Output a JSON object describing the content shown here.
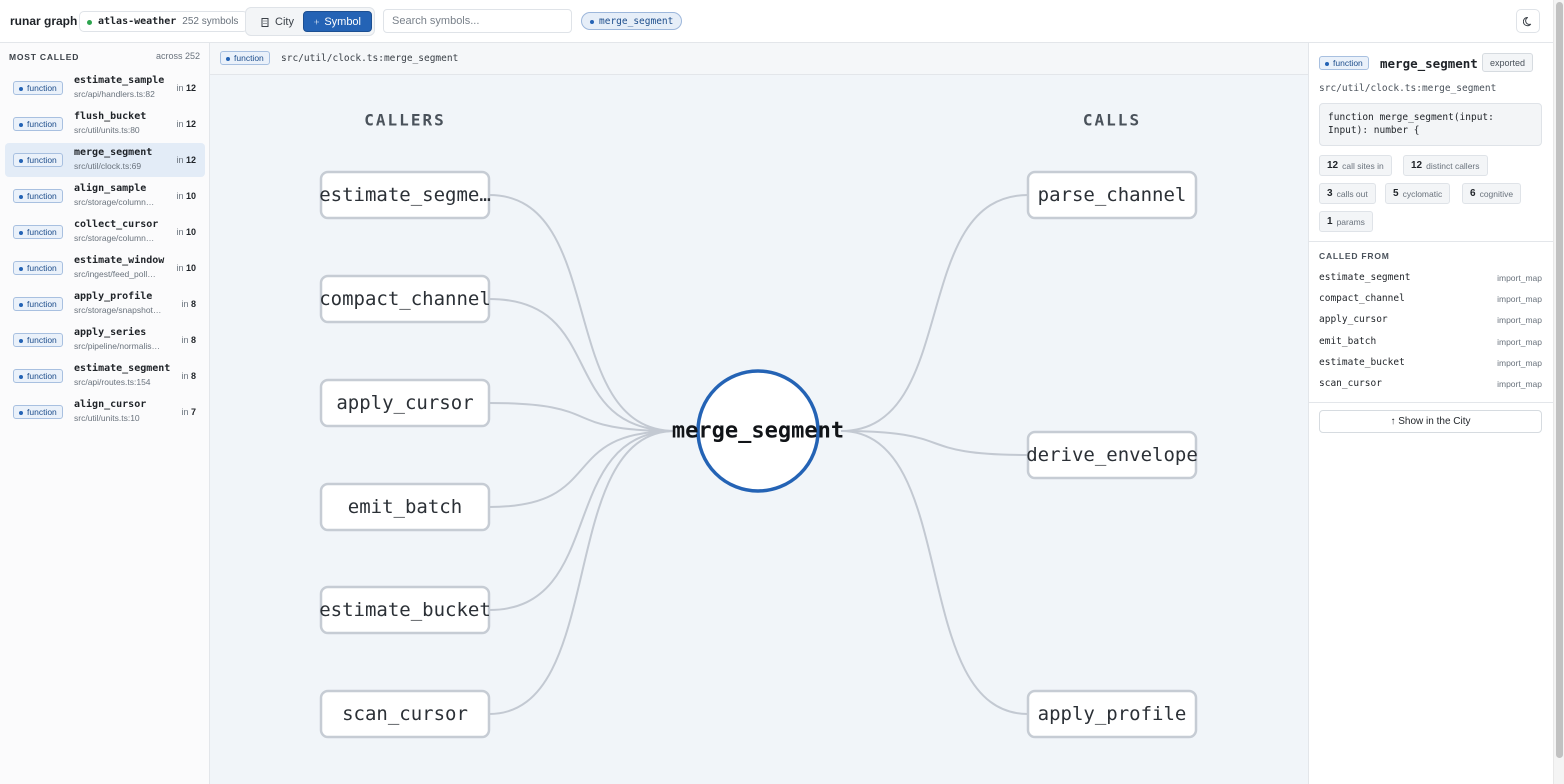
{
  "topbar": {
    "app_title": "runar graph",
    "repo": {
      "name": "atlas-weather",
      "count": "252 symbols",
      "status_color": "#2da44e"
    },
    "modes": {
      "city": "City",
      "symbol": "Symbol",
      "active": "Symbol",
      "city_icon": "building-icon",
      "symbol_icon": "node-graph-icon"
    },
    "search": {
      "placeholder": "Search symbols...",
      "value": ""
    },
    "selected_symbol": "merge_segment",
    "theme_icon": "moon-icon"
  },
  "sidebar": {
    "title": "MOST CALLED",
    "meta": "across 252",
    "items": [
      {
        "kind": "function",
        "name": "estimate_sample",
        "path": "src/api/handlers.ts:82",
        "count_prefix": "in",
        "count": "12",
        "active": false
      },
      {
        "kind": "function",
        "name": "flush_bucket",
        "path": "src/util/units.ts:80",
        "count_prefix": "in",
        "count": "12",
        "active": false
      },
      {
        "kind": "function",
        "name": "merge_segment",
        "path": "src/util/clock.ts:69",
        "count_prefix": "in",
        "count": "12",
        "active": true
      },
      {
        "kind": "function",
        "name": "align_sample",
        "path": "src/storage/column…",
        "count_prefix": "in",
        "count": "10",
        "active": false
      },
      {
        "kind": "function",
        "name": "collect_cursor",
        "path": "src/storage/column…",
        "count_prefix": "in",
        "count": "10",
        "active": false
      },
      {
        "kind": "function",
        "name": "estimate_window",
        "path": "src/ingest/feed_poll…",
        "count_prefix": "in",
        "count": "10",
        "active": false
      },
      {
        "kind": "function",
        "name": "apply_profile",
        "path": "src/storage/snapshot…",
        "count_prefix": "in",
        "count": "8",
        "active": false
      },
      {
        "kind": "function",
        "name": "apply_series",
        "path": "src/pipeline/normalis…",
        "count_prefix": "in",
        "count": "8",
        "active": false
      },
      {
        "kind": "function",
        "name": "estimate_segment",
        "path": "src/api/routes.ts:154",
        "count_prefix": "in",
        "count": "8",
        "active": false
      },
      {
        "kind": "function",
        "name": "align_cursor",
        "path": "src/util/units.ts:10",
        "count_prefix": "in",
        "count": "7",
        "active": false
      }
    ]
  },
  "main": {
    "breadcrumb": {
      "kind": "function",
      "path": "src/util/clock.ts:merge_segment"
    },
    "graph": {
      "callers_heading": "CALLERS",
      "calls_heading": "CALLS",
      "center": "merge_segment",
      "callers": [
        "estimate_segme…",
        "compact_channel",
        "apply_cursor",
        "emit_batch",
        "estimate_bucket",
        "scan_cursor"
      ],
      "calls": [
        "parse_channel",
        "derive_envelope",
        "apply_profile"
      ]
    }
  },
  "panel": {
    "kind": "function",
    "name": "merge_segment",
    "exported": "exported",
    "path": "src/util/clock.ts:merge_segment",
    "signature_line1": "function merge_segment(input:",
    "signature_line2": "Input): number {",
    "stats": [
      {
        "value": "12",
        "label": "call sites in"
      },
      {
        "value": "12",
        "label": "distinct callers"
      },
      {
        "value": "3",
        "label": "calls out"
      },
      {
        "value": "5",
        "label": "cyclomatic"
      },
      {
        "value": "6",
        "label": "cognitive"
      },
      {
        "value": "1",
        "label": "params"
      }
    ],
    "called_from_title": "CALLED FROM",
    "called_from": [
      {
        "name": "estimate_segment",
        "via": "import_map"
      },
      {
        "name": "compact_channel",
        "via": "import_map"
      },
      {
        "name": "apply_cursor",
        "via": "import_map"
      },
      {
        "name": "emit_batch",
        "via": "import_map"
      },
      {
        "name": "estimate_bucket",
        "via": "import_map"
      },
      {
        "name": "scan_cursor",
        "via": "import_map"
      }
    ],
    "show_city": "↑ Show in the City"
  },
  "colors": {
    "accent": "#2463b5",
    "edge": "#c3c9d2",
    "node_border": "#c6ccd4"
  }
}
